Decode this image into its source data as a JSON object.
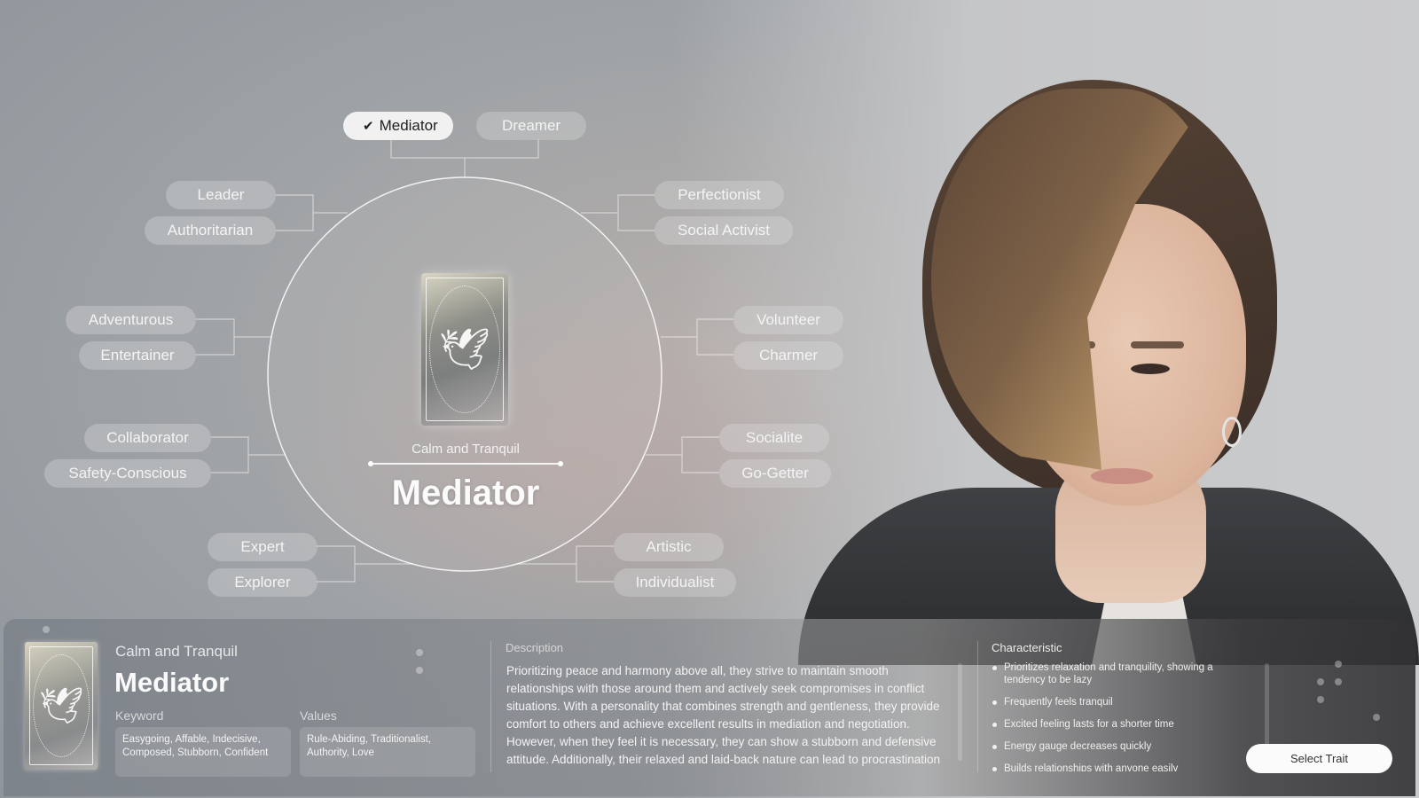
{
  "wheel": {
    "center": {
      "subtitle": "Calm and Tranquil",
      "title": "Mediator",
      "card_icon": "dove-card-icon"
    },
    "traits": [
      {
        "label": "Mediator",
        "selected": true
      },
      {
        "label": "Dreamer",
        "selected": false
      },
      {
        "label": "Perfectionist",
        "selected": false
      },
      {
        "label": "Social Activist",
        "selected": false
      },
      {
        "label": "Volunteer",
        "selected": false
      },
      {
        "label": "Charmer",
        "selected": false
      },
      {
        "label": "Socialite",
        "selected": false
      },
      {
        "label": "Go-Getter",
        "selected": false
      },
      {
        "label": "Artistic",
        "selected": false
      },
      {
        "label": "Individualist",
        "selected": false
      },
      {
        "label": "Expert",
        "selected": false
      },
      {
        "label": "Explorer",
        "selected": false
      },
      {
        "label": "Collaborator",
        "selected": false
      },
      {
        "label": "Safety-Conscious",
        "selected": false
      },
      {
        "label": "Adventurous",
        "selected": false
      },
      {
        "label": "Entertainer",
        "selected": false
      },
      {
        "label": "Leader",
        "selected": false
      },
      {
        "label": "Authoritarian",
        "selected": false
      }
    ],
    "check_glyph": "✔"
  },
  "panel": {
    "subtitle": "Calm and Tranquil",
    "title": "Mediator",
    "keyword_label": "Keyword",
    "keyword_value": "Easygoing, Affable, Indecisive, Composed, Stubborn, Confident",
    "values_label": "Values",
    "values_value": "Rule-Abiding, Traditionalist, Authority, Love",
    "description_label": "Description",
    "description": "Prioritizing peace and harmony above all, they strive to maintain smooth relationships with those around them and actively seek compromises in conflict situations. With a personality that combines strength and gentleness, they provide comfort to others and achieve excellent results in mediation and negotiation. However, when they feel it is necessary, they can show a stubborn and defensive attitude. Additionally, their relaxed and laid-back nature can lead to procrastination",
    "characteristic_label": "Characteristic",
    "characteristics": [
      "Prioritizes relaxation and tranquility, showing a tendency to be lazy",
      "Frequently feels tranquil",
      "Excited feeling lasts for a shorter time",
      "Energy gauge decreases quickly",
      "Builds relationships with anyone easily"
    ],
    "select_button": "Select Trait"
  },
  "icons": {
    "dove": "🕊"
  }
}
